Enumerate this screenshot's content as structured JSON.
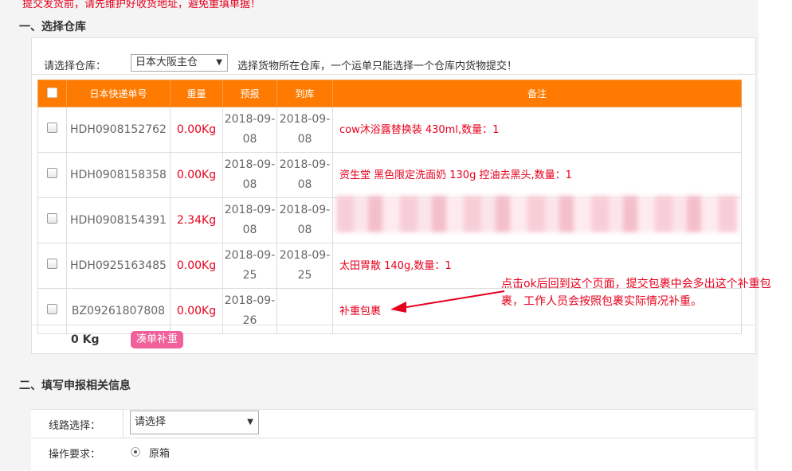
{
  "notice": "提交发货前，请先维护好收货地址，避免重填单据！",
  "section1": {
    "title": "一、选择仓库",
    "warehouse_label": "请选择仓库：",
    "warehouse_value": "日本大阪主仓",
    "warehouse_tip": "选择货物所在仓库，一个运单只能选择一个仓库内货物提交！"
  },
  "table": {
    "headers": [
      "日本快递单号",
      "重量",
      "预报",
      "到库",
      "备注"
    ],
    "rows": [
      {
        "no": "HDH0908152762",
        "weight": "0.00Kg",
        "forecast": "2018-09-08",
        "arrived": "2018-09-08",
        "note": "cow沐浴露替换装 430ml,数量：1"
      },
      {
        "no": "HDH0908158358",
        "weight": "0.00Kg",
        "forecast": "2018-09-08",
        "arrived": "2018-09-08",
        "note": "资生堂 黑色限定洗面奶 130g 控油去黑头,数量：1"
      },
      {
        "no": "HDH0908154391",
        "weight": "2.34Kg",
        "forecast": "2018-09-08",
        "arrived": "2018-09-08",
        "note": ""
      },
      {
        "no": "HDH0925163485",
        "weight": "0.00Kg",
        "forecast": "2018-09-25",
        "arrived": "2018-09-25",
        "note": "太田胃散 140g,数量：1"
      },
      {
        "no": "BZ09261807808",
        "weight": "0.00Kg",
        "forecast": "2018-09-26",
        "arrived": "",
        "note": "补重包裹"
      }
    ],
    "total_weight": "0 Kg",
    "combine_button": "凑单补重"
  },
  "annotation": "点击ok后回到这个页面，提交包裹中会多出这个补重包裹，工作人员会按照包裹实际情况补重。",
  "section2": {
    "title": "二、填写申报相关信息",
    "route_label": "线路选择：",
    "route_value": "请选择",
    "op_label": "操作要求：",
    "op_option": "原箱"
  },
  "colors": {
    "header": "#ff7a00",
    "alert": "#e6001d",
    "button": "#f0609a"
  }
}
